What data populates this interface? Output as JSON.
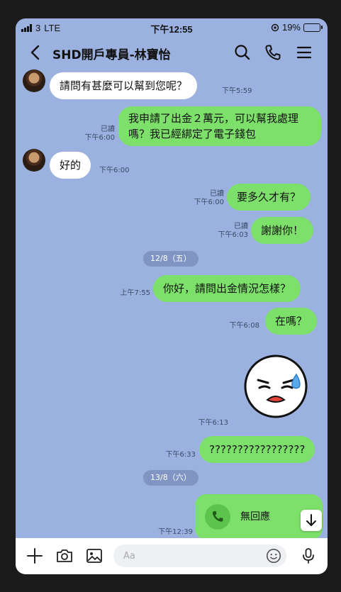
{
  "status_bar": {
    "carrier": "3",
    "network": "LTE",
    "time": "下午12:55",
    "battery_percent": "19%",
    "battery_level": 0.19
  },
  "header": {
    "title": "SHD開戶專員-林寶怡",
    "icons": [
      "back-icon",
      "search-icon",
      "phone-icon",
      "menu-icon"
    ]
  },
  "messages": [
    {
      "side": "in",
      "text": "請問有甚麼可以幫到您呢？",
      "time": "下午5:59"
    },
    {
      "side": "out",
      "text": "我申請了出金２萬元，可以幫我處理嗎？我已經綁定了電子錢包",
      "read": "已讀",
      "time": "下午6:00"
    },
    {
      "side": "in",
      "text": "好的",
      "time": "下午6:00"
    },
    {
      "side": "out",
      "text": "要多久才有？",
      "read": "已讀",
      "time": "下午6:00"
    },
    {
      "side": "out",
      "text": "謝謝你！",
      "read": "已讀",
      "time": "下午6:03"
    },
    {
      "side": "out",
      "text": "你好，請問出金情況怎樣？",
      "time": "上午7:55"
    },
    {
      "side": "out",
      "text": "在嗎？",
      "time": "下午6:08"
    },
    {
      "side": "out",
      "text": "",
      "time": "下午6:13",
      "sticker": "crying-face-sticker"
    },
    {
      "side": "out",
      "text": "?????????????????",
      "time": "下午6:33"
    },
    {
      "side": "out",
      "text": "無回應",
      "time": "下午12:39",
      "call": true
    }
  ],
  "date_separators": [
    "12/8（五）",
    "13/8（六）"
  ],
  "input_bar": {
    "placeholder": "Aa",
    "icons": [
      "plus-icon",
      "camera-icon",
      "image-icon",
      "emoji-icon",
      "microphone-icon"
    ]
  },
  "colors": {
    "chat_background": "#9bb1df",
    "outgoing_bubble": "#7de06a",
    "incoming_bubble": "#ffffff",
    "date_chip": "#8095c4"
  }
}
